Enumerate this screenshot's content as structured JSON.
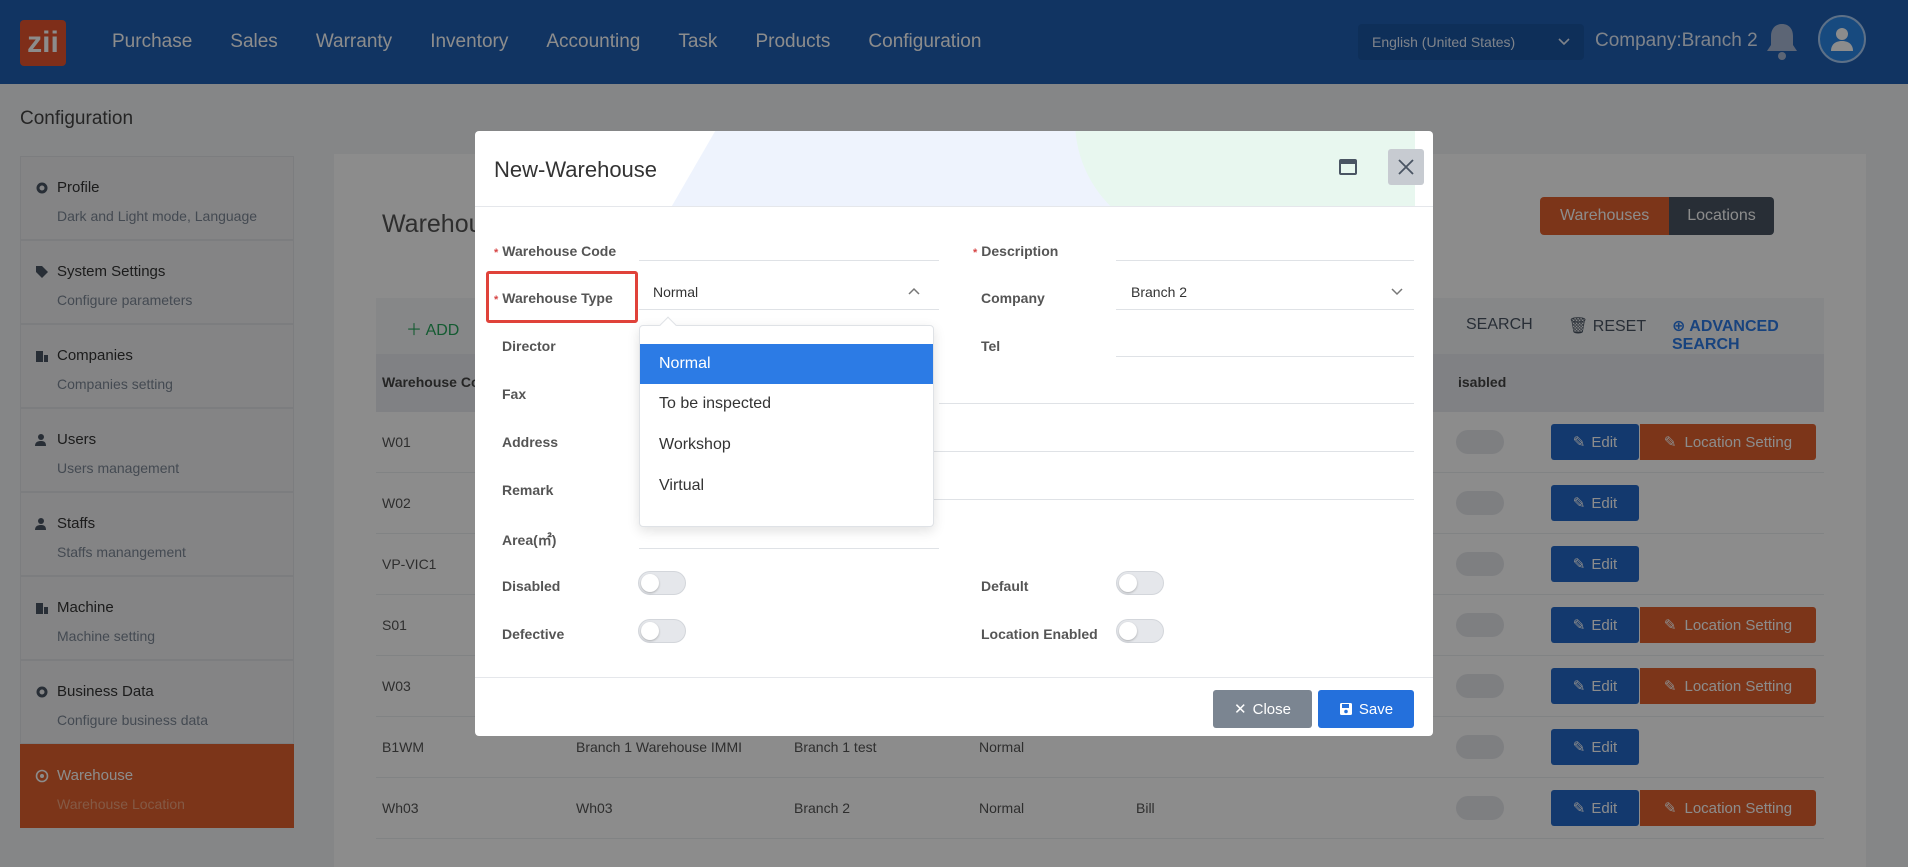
{
  "app": {
    "logo": "zii"
  },
  "nav": [
    "Purchase",
    "Sales",
    "Warranty",
    "Inventory",
    "Accounting",
    "Task",
    "Products",
    "Configuration"
  ],
  "header": {
    "language": "English (United States)",
    "company": "Company:Branch 2"
  },
  "page_title": "Configuration",
  "sidebar": [
    {
      "title": "Profile",
      "sub": "Dark and Light mode, Language"
    },
    {
      "title": "System Settings",
      "sub": "Configure parameters"
    },
    {
      "title": "Companies",
      "sub": "Companies setting"
    },
    {
      "title": "Users",
      "sub": "Users management"
    },
    {
      "title": "Staffs",
      "sub": "Staffs manangement"
    },
    {
      "title": "Machine",
      "sub": "Machine setting"
    },
    {
      "title": "Business Data",
      "sub": "Configure business data"
    },
    {
      "title": "Warehouse",
      "sub": "Warehouse Location"
    }
  ],
  "main": {
    "title": "Warehou",
    "seg": [
      "Warehouses",
      "Locations"
    ],
    "toolbar": {
      "add": "ADD",
      "search": "SEARCH",
      "reset": "RESET",
      "advanced": "ADVANCED SEARCH"
    },
    "headers": {
      "code": "Warehouse Co",
      "disabled": "isabled"
    },
    "rows": [
      {
        "code": "W01",
        "name": "",
        "company": "",
        "type": "",
        "director": ""
      },
      {
        "code": "W02",
        "name": "",
        "company": "",
        "type": "",
        "director": ""
      },
      {
        "code": "VP-VIC1",
        "name": "",
        "company": "",
        "type": "",
        "director": ""
      },
      {
        "code": "S01",
        "name": "",
        "company": "",
        "type": "",
        "director": ""
      },
      {
        "code": "W03",
        "name": "",
        "company": "",
        "type": "",
        "director": ""
      },
      {
        "code": "B1WM",
        "name": "Branch 1 Warehouse IMMI",
        "company": "Branch 1 test",
        "type": "Normal",
        "director": ""
      },
      {
        "code": "Wh03",
        "name": "Wh03",
        "company": "Branch 2",
        "type": "Normal",
        "director": "Bill"
      }
    ],
    "edit_label": "Edit",
    "location_label": "Location Setting"
  },
  "modal": {
    "title": "New-Warehouse",
    "labels": {
      "code": "Warehouse Code",
      "description": "Description",
      "type": "Warehouse Type",
      "company": "Company",
      "director": "Director",
      "tel": "Tel",
      "fax": "Fax",
      "address": "Address",
      "remark": "Remark",
      "area": "Area(㎡)",
      "disabled": "Disabled",
      "default": "Default",
      "defective": "Defective",
      "location_enabled": "Location Enabled"
    },
    "values": {
      "type": "Normal",
      "company": "Branch 2"
    },
    "close": "Close",
    "save": "Save"
  },
  "dropdown": {
    "options": [
      "Normal",
      "To be inspected",
      "Workshop",
      "Virtual"
    ],
    "selected": "Normal"
  }
}
